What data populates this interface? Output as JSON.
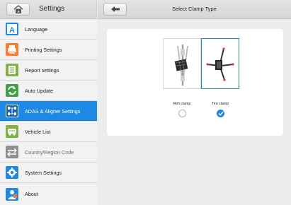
{
  "sidebar": {
    "title": "Settings",
    "items": [
      {
        "label": "Language",
        "icon": "language-icon",
        "color": "#1e88e5"
      },
      {
        "label": "Printing Settings",
        "icon": "printer-icon",
        "color": "#ff7a2e"
      },
      {
        "label": "Report settings",
        "icon": "report-icon",
        "color": "#7cb342"
      },
      {
        "label": "Auto Update",
        "icon": "update-icon",
        "color": "#43a047"
      },
      {
        "label": "ADAS & Aligner Settings",
        "icon": "adas-icon",
        "color": "#1e88e5"
      },
      {
        "label": "Vehicle List",
        "icon": "vehicle-list-icon",
        "color": "#7cb342"
      },
      {
        "label": "Country/Region Code",
        "icon": "swap-arrows-icon",
        "color": "#8e8e8e"
      },
      {
        "label": "System Settings",
        "icon": "gear-icon",
        "color": "#1e88e5"
      },
      {
        "label": "About",
        "icon": "about-icon",
        "color": "#1e88e5"
      }
    ],
    "active_index": 4
  },
  "main": {
    "title": "Select Clamp Type",
    "options": [
      {
        "label": "Rim clamp",
        "selected": false
      },
      {
        "label": "Tire clamp",
        "selected": true
      }
    ]
  },
  "colors": {
    "accent": "#1e88e5"
  }
}
